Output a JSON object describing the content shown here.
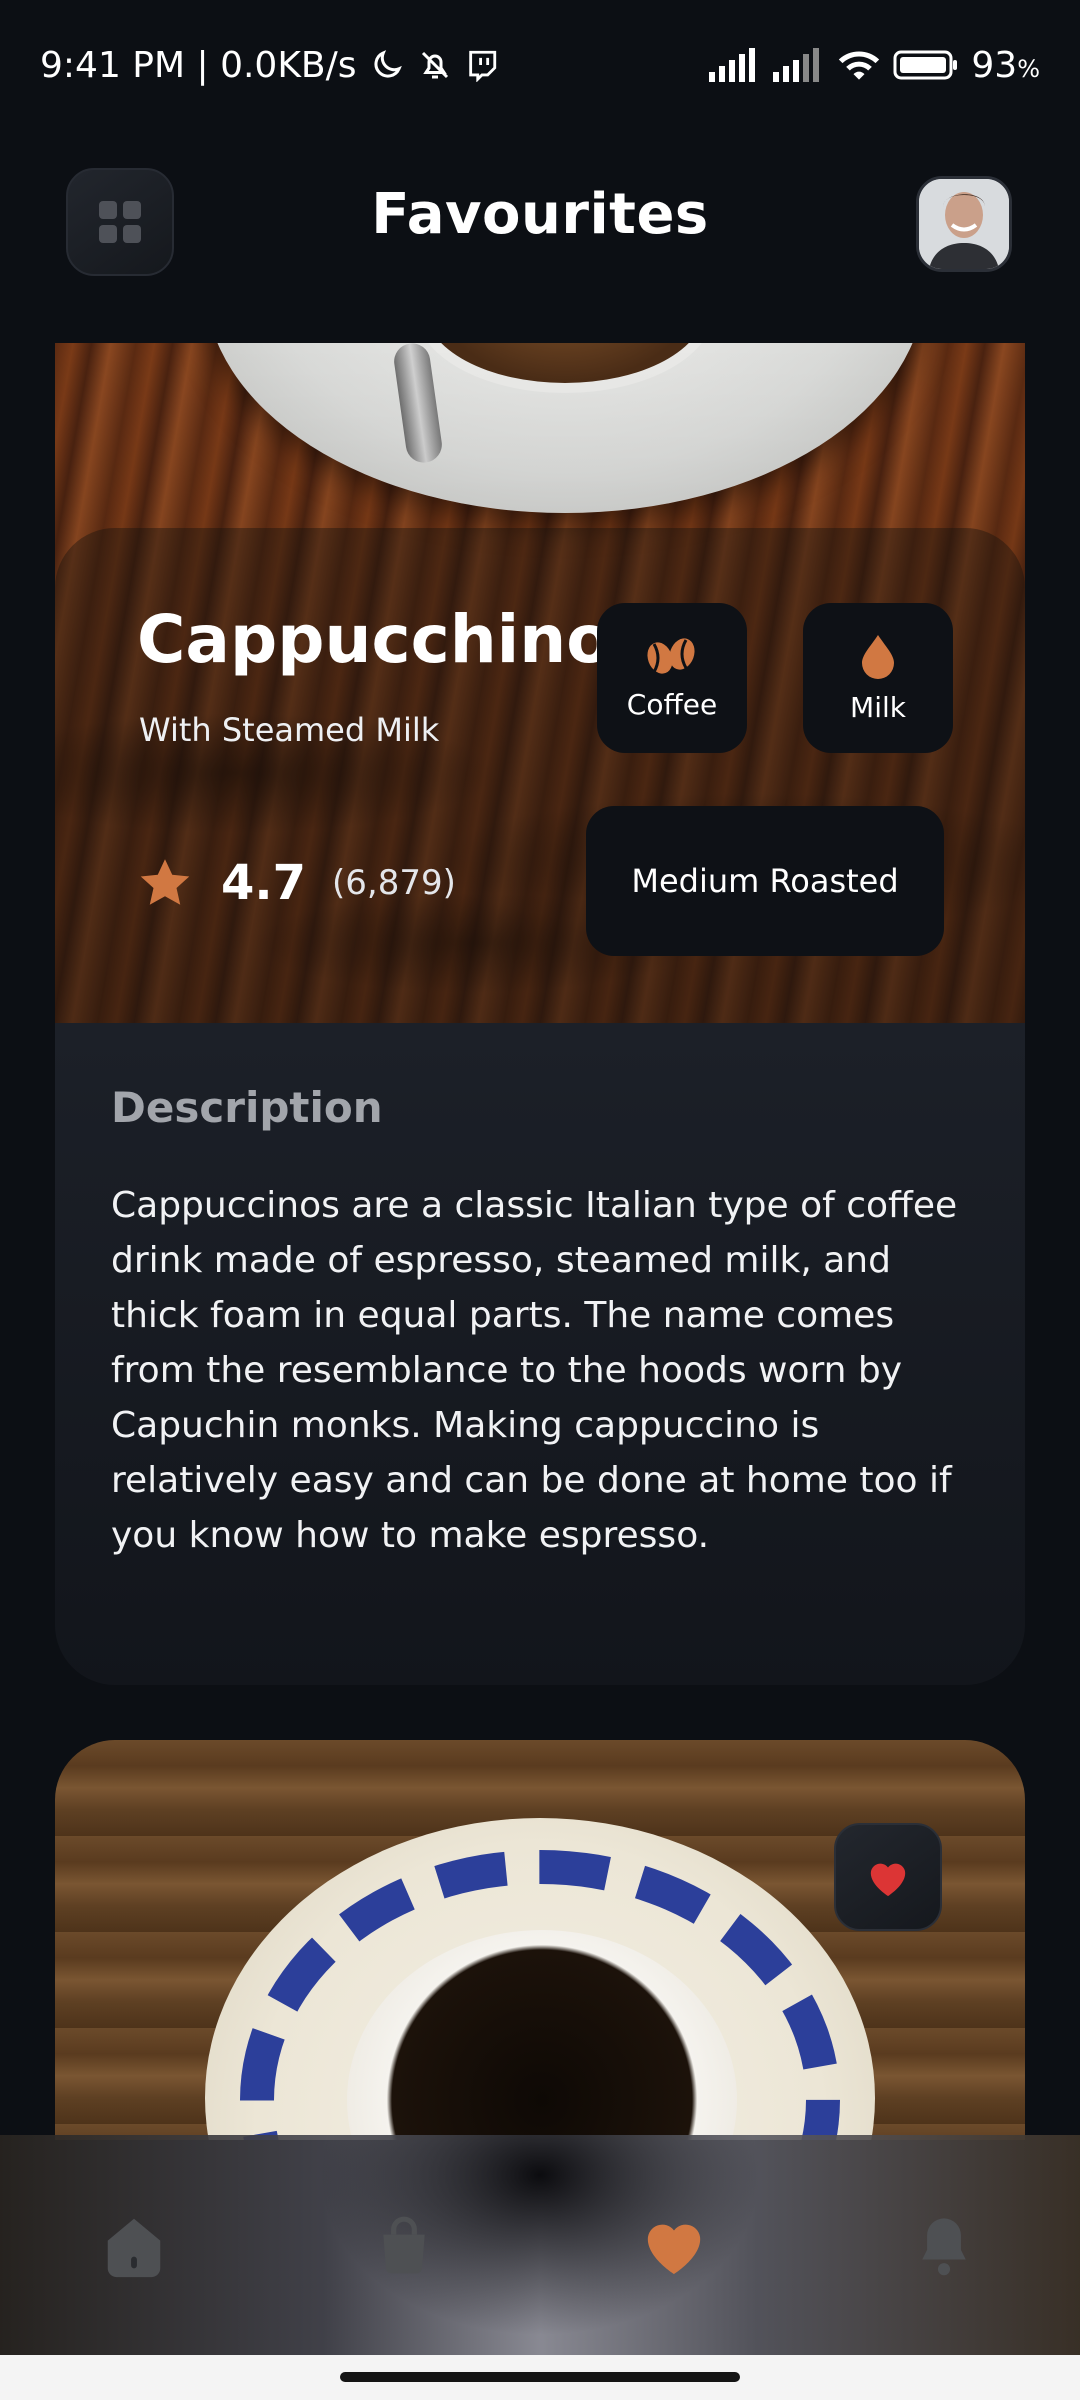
{
  "status_bar": {
    "time_speed": "9:41 PM | 0.0KB/s",
    "battery": "93",
    "battery_unit": "%",
    "icons": [
      "moon-icon",
      "bell-off-icon",
      "twitch-icon",
      "signal-icon",
      "signal-icon",
      "wifi-icon",
      "battery-icon"
    ]
  },
  "header": {
    "title": "Favourites",
    "menu_icon": "grid-icon",
    "avatar": "profile-avatar"
  },
  "favourite_item": {
    "name": "Cappucchino",
    "subtitle": "With Steamed Milk",
    "rating": "4.7",
    "rating_count": "(6,879)",
    "chips": {
      "coffee": "Coffee",
      "milk": "Milk",
      "roast": "Medium Roasted"
    },
    "description_title": "Description",
    "description": "Cappuccinos are a classic Italian type of coffee drink made of espresso, steamed milk, and thick foam in equal parts. The name comes from the resemblance to the hoods worn by Capuchin monks. Making cappuccino is relatively easy and can be done at home too if you know how to make espresso."
  },
  "nav": {
    "items": [
      "home-icon",
      "bag-icon",
      "heart-icon",
      "bell-icon"
    ],
    "active": "heart-icon"
  },
  "colors": {
    "accent": "#D17842",
    "background": "#0C0F14",
    "chip_bg": "#0E1116",
    "inactive_icon": "#4E5053",
    "fav_red": "#DC3535"
  }
}
